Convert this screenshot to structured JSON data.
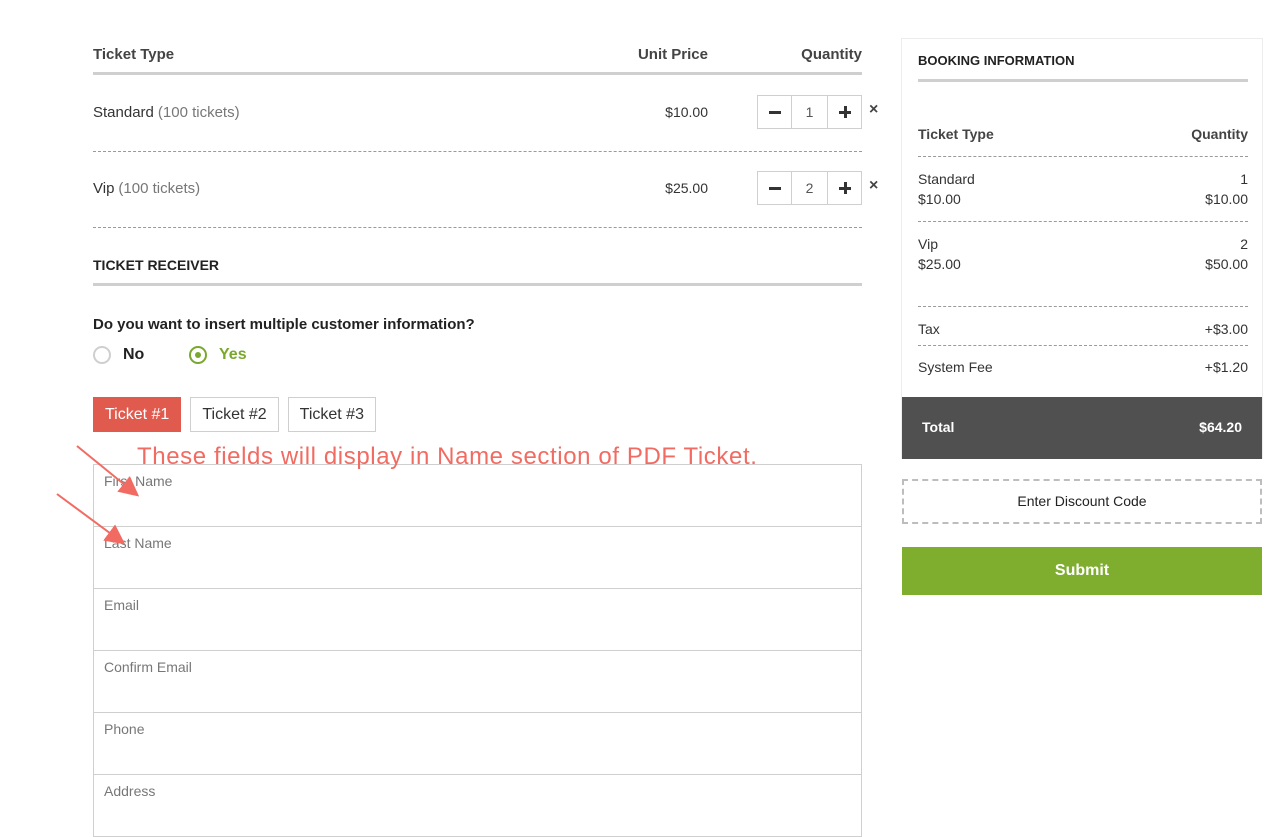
{
  "ticket_table": {
    "headers": {
      "type": "Ticket Type",
      "price": "Unit Price",
      "quantity": "Quantity"
    },
    "rows": [
      {
        "name": "Standard",
        "count": "(100 tickets)",
        "price": "$10.00",
        "qty": "1",
        "remove": "×"
      },
      {
        "name": "Vip",
        "count": "(100 tickets)",
        "price": "$25.00",
        "qty": "2",
        "remove": "×"
      }
    ]
  },
  "receiver": {
    "title": "TICKET RECEIVER",
    "question": "Do you want to insert multiple customer information?",
    "options": {
      "no": "No",
      "yes": "Yes"
    },
    "selected": "yes",
    "tabs": [
      "Ticket #1",
      "Ticket #2",
      "Ticket #3"
    ],
    "active_tab": 0,
    "annotation": "These fields will display in Name section of PDF Ticket.",
    "fields": [
      "First Name",
      "Last Name",
      "Email",
      "Confirm Email",
      "Phone",
      "Address"
    ]
  },
  "booking": {
    "title": "BOOKING INFORMATION",
    "headers": {
      "type": "Ticket Type",
      "quantity": "Quantity"
    },
    "items": [
      {
        "name": "Standard",
        "qty": "1",
        "unit": "$10.00",
        "subtotal": "$10.00"
      },
      {
        "name": "Vip",
        "qty": "2",
        "unit": "$25.00",
        "subtotal": "$50.00"
      }
    ],
    "tax": {
      "label": "Tax",
      "value": "+$3.00"
    },
    "system_fee": {
      "label": "System Fee",
      "value": "+$1.20"
    },
    "total": {
      "label": "Total",
      "value": "$64.20"
    }
  },
  "discount_label": "Enter Discount Code",
  "submit_label": "Submit",
  "colors": {
    "accent_red": "#e05a4e",
    "accent_green": "#7fae2f",
    "total_bg": "#505050",
    "annotation": "#f26b62"
  }
}
